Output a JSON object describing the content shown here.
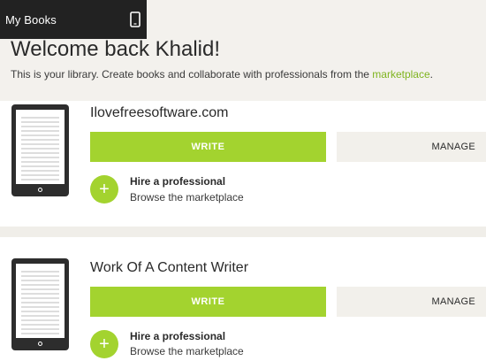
{
  "topbar": {
    "title": "My Books",
    "device_icon": "mobile-device-icon"
  },
  "header": {
    "welcome": "Welcome back Khalid!",
    "subtitle": "This is your library. Create books and collaborate with professionals from the ",
    "marketplace_link": "marketplace",
    "subtitle_end": "."
  },
  "books": [
    {
      "title": "Ilovefreesoftware.com",
      "write_label": "WRITE",
      "manage_label": "MANAGE",
      "hire_title": "Hire a professional",
      "hire_sub": "Browse the marketplace"
    },
    {
      "title": "Work Of A Content Writer",
      "write_label": "WRITE",
      "manage_label": "MANAGE",
      "hire_title": "Hire a professional",
      "hire_sub": "Browse the marketplace"
    }
  ],
  "colors": {
    "accent": "#a3d32f",
    "link": "#7fb41f",
    "topbar": "#222222"
  }
}
